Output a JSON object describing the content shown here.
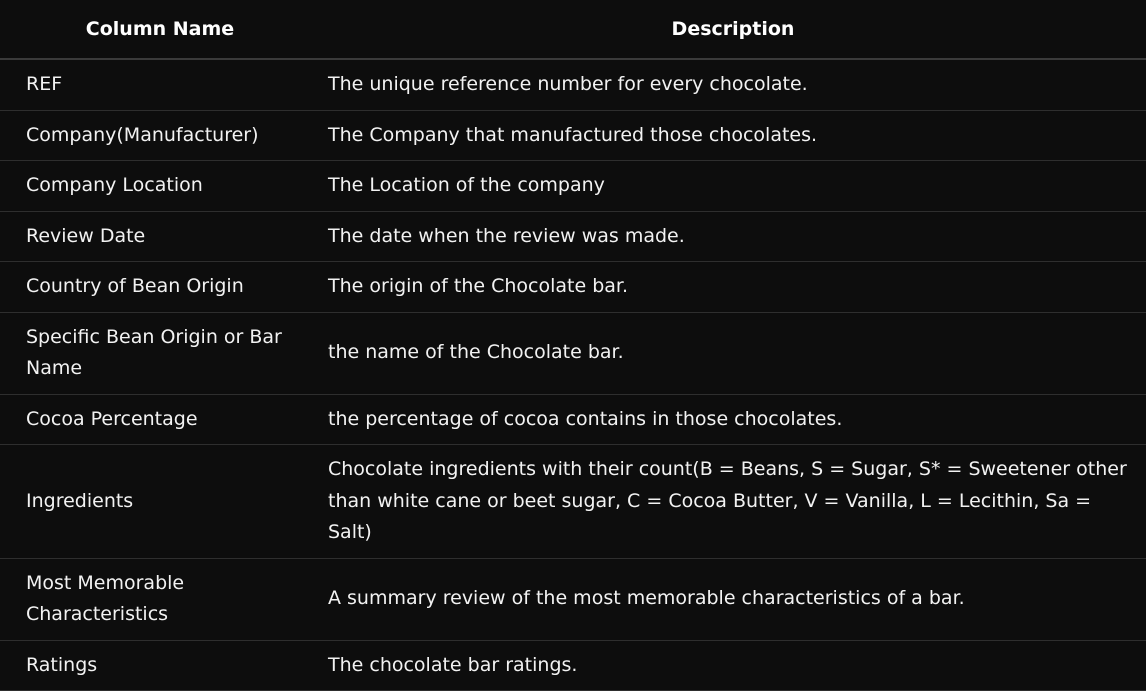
{
  "table": {
    "headers": {
      "column_name": "Column Name",
      "description": "Description"
    },
    "rows": [
      {
        "name": "REF",
        "description": "The unique reference number for every chocolate."
      },
      {
        "name": "Company(Manufacturer)",
        "description": "The Company that manufactured those chocolates."
      },
      {
        "name": "Company Location",
        "description": "The Location of the company"
      },
      {
        "name": "Review Date",
        "description": "The date when the review was made."
      },
      {
        "name": "Country of Bean Origin",
        "description": "The origin of the Chocolate bar."
      },
      {
        "name": "Specific Bean Origin or Bar Name",
        "description": "the name of the Chocolate bar."
      },
      {
        "name": "Cocoa Percentage",
        "description": "the percentage of cocoa contains in those chocolates."
      },
      {
        "name": "Ingredients",
        "description": "Chocolate ingredients with their count(B = Beans, S = Sugar, S* = Sweetener other than white cane or beet sugar, C = Cocoa Butter, V = Vanilla, L = Lecithin, Sa = Salt)"
      },
      {
        "name": "Most Memorable Characteristics",
        "description": "A summary review of the most memorable characteristics of a bar."
      },
      {
        "name": "Ratings",
        "description": "The chocolate bar ratings."
      }
    ]
  }
}
